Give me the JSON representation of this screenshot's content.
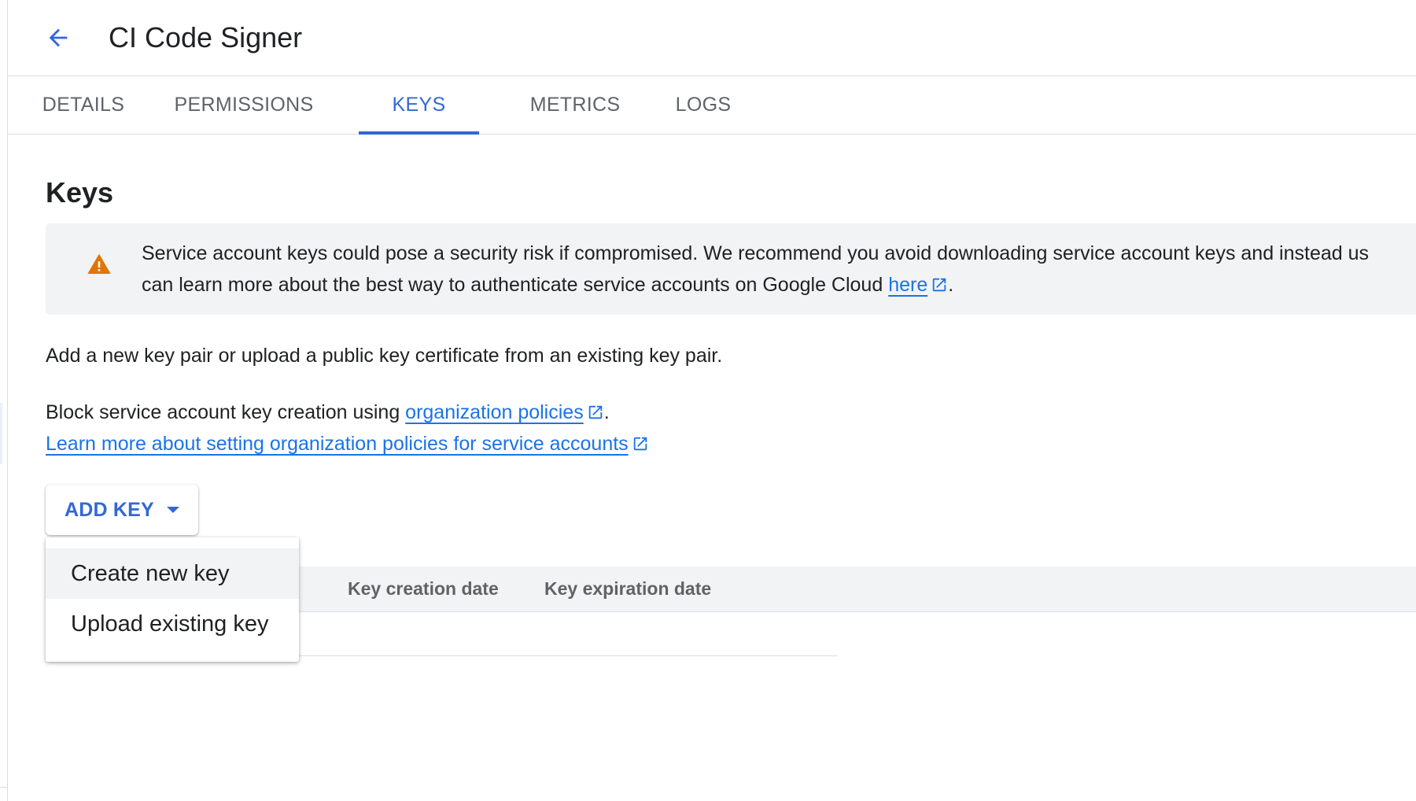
{
  "header": {
    "back_icon": "arrow-back-icon",
    "title": "CI Code Signer"
  },
  "tabs": [
    {
      "label": "DETAILS",
      "active": false
    },
    {
      "label": "PERMISSIONS",
      "active": false
    },
    {
      "label": "KEYS",
      "active": true
    },
    {
      "label": "METRICS",
      "active": false
    },
    {
      "label": "LOGS",
      "active": false
    }
  ],
  "main": {
    "section_title": "Keys",
    "warning": {
      "icon": "warning-triangle-icon",
      "line1": "Service account keys could pose a security risk if compromised. We recommend you avoid downloading service account keys and instead us",
      "line2_prefix": "can learn more about the best way to authenticate service accounts on Google Cloud ",
      "link": "here",
      "line2_suffix": "."
    },
    "intro_text": "Add a new key pair or upload a public key certificate from an existing key pair.",
    "block_text_prefix": "Block service account key creation using ",
    "block_link": "organization policies",
    "block_text_suffix": ".",
    "learn_more_link": "Learn more about setting organization policies for service accounts",
    "add_key_button": "ADD KEY",
    "table": {
      "columns": [
        "Key creation date",
        "Key expiration date"
      ]
    },
    "add_key_menu": {
      "items": [
        "Create new key",
        "Upload existing key"
      ],
      "highlighted_index": 0
    }
  },
  "colors": {
    "accent": "#3367d6",
    "link": "#1a73e8",
    "warning": "#e37400",
    "panel": "#f1f3f4"
  }
}
